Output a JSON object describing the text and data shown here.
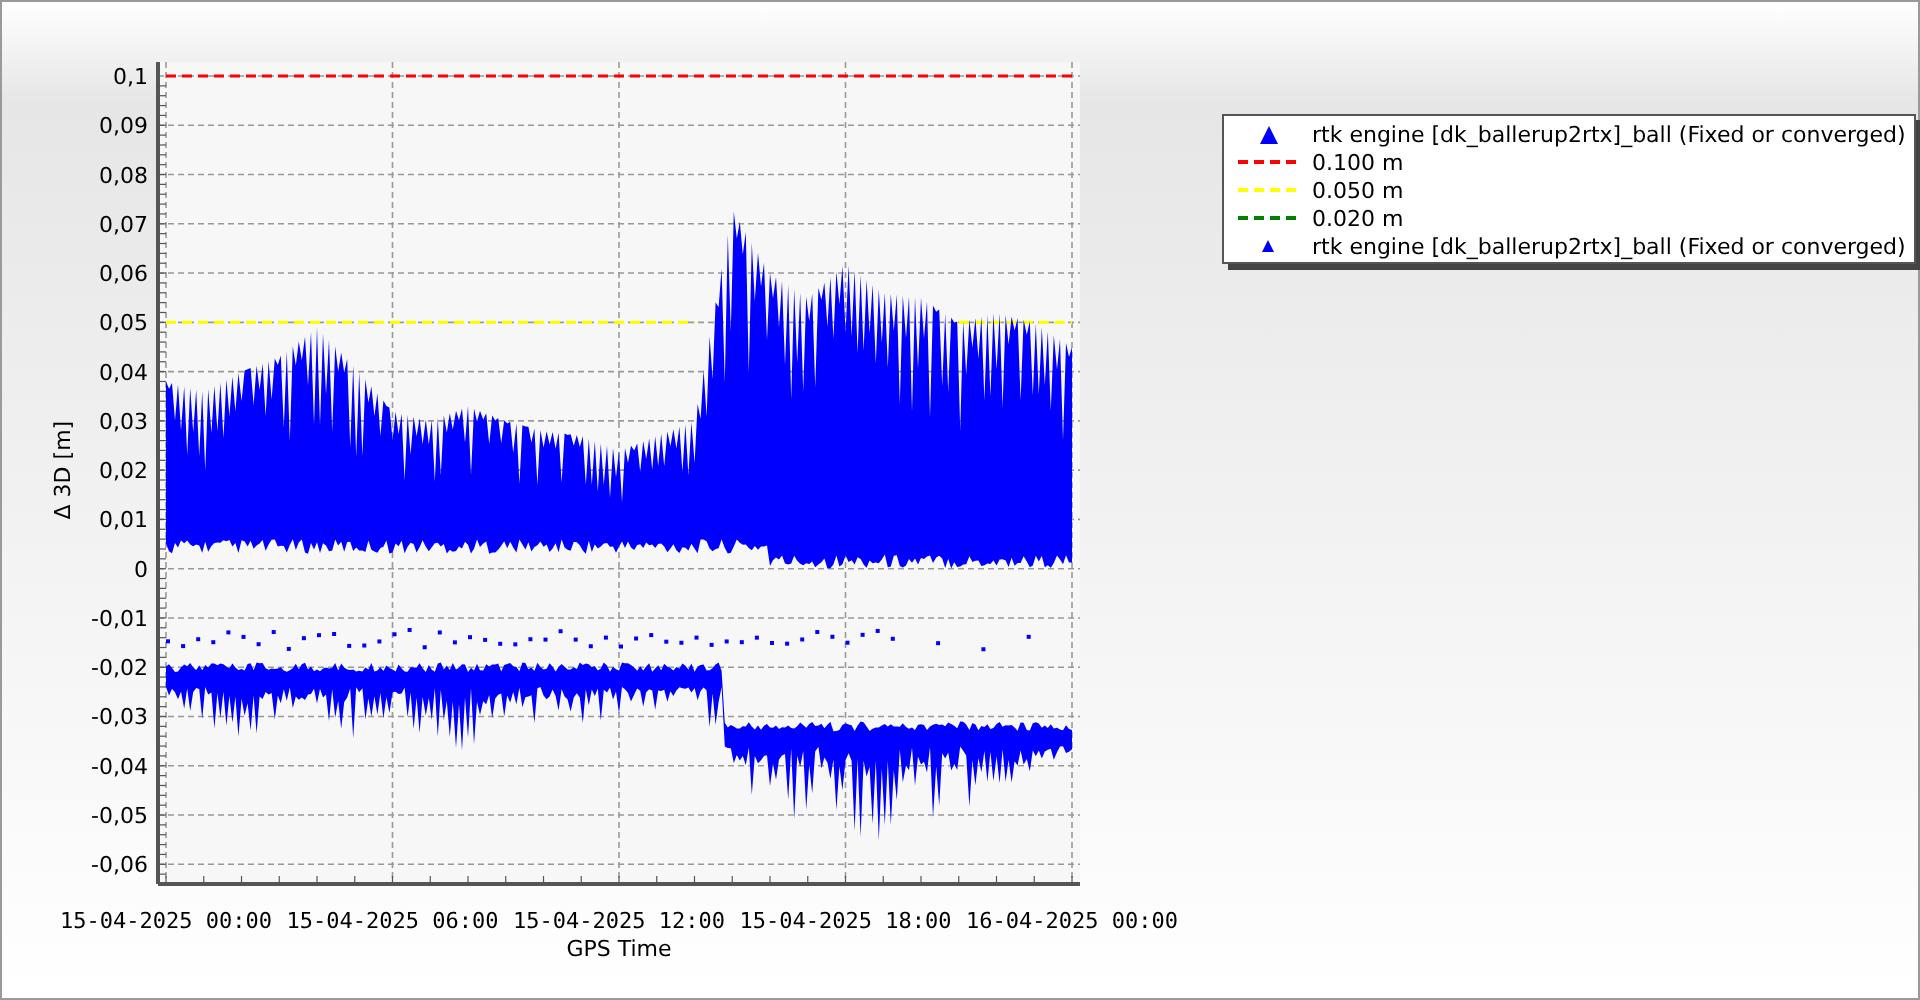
{
  "chart_data": {
    "type": "line",
    "xlabel": "GPS Time",
    "ylabel": "Δ 3D [m]",
    "grid": true,
    "categories": [
      "15-04-2025 00:00",
      null,
      null,
      null,
      null,
      null,
      "15-04-2025 06:00",
      null,
      null,
      null,
      null,
      null,
      "15-04-2025 12:00",
      null,
      null,
      null,
      null,
      null,
      "15-04-2025 18:00",
      null,
      null,
      null,
      null,
      null,
      "16-04-2025 00:00"
    ],
    "ylim": [
      -0.064,
      0.1
    ],
    "yticks": [
      {
        "value": 0.1,
        "label": "0,1"
      },
      {
        "value": 0.09,
        "label": "0,09"
      },
      {
        "value": 0.08,
        "label": "0,08"
      },
      {
        "value": 0.07,
        "label": "0,07"
      },
      {
        "value": 0.06,
        "label": "0,06"
      },
      {
        "value": 0.05,
        "label": "0,05"
      },
      {
        "value": 0.04,
        "label": "0,04"
      },
      {
        "value": 0.03,
        "label": "0,03"
      },
      {
        "value": 0.02,
        "label": "0,02"
      },
      {
        "value": 0.01,
        "label": "0,01"
      },
      {
        "value": 0,
        "label": "0"
      },
      {
        "value": -0.01,
        "label": "-0,01"
      },
      {
        "value": -0.02,
        "label": "-0,02"
      },
      {
        "value": -0.03,
        "label": "-0,03"
      },
      {
        "value": -0.04,
        "label": "-0,04"
      },
      {
        "value": -0.05,
        "label": "-0,05"
      },
      {
        "value": -0.06,
        "label": "-0,06"
      }
    ],
    "series": [
      {
        "name": "0.100 m",
        "color": "#ff0000",
        "line_style": "dashed",
        "values": [
          0.1,
          0.1,
          0.1,
          0.1,
          0.1,
          0.1,
          0.1,
          0.1,
          0.1,
          0.1,
          0.1,
          0.1,
          0.1,
          0.1,
          0.1,
          0.1,
          0.1,
          0.1,
          0.1,
          0.1,
          0.1,
          0.1,
          0.1,
          0.1,
          0.1
        ]
      },
      {
        "name": "0.050 m",
        "color": "#ffff00",
        "line_style": "dashed",
        "values": [
          0.05,
          0.05,
          0.05,
          0.05,
          0.05,
          0.05,
          0.05,
          0.05,
          0.05,
          0.05,
          0.05,
          0.05,
          0.05,
          0.05,
          0.05,
          null,
          null,
          null,
          null,
          null,
          null,
          0.05,
          0.05,
          0.05,
          0.05
        ]
      },
      {
        "name": "0.020 m",
        "color": "#008000",
        "line_style": "dashed",
        "values": [
          null,
          null,
          null,
          null,
          null,
          null,
          null,
          null,
          null,
          null,
          null,
          null,
          null,
          null,
          null,
          null,
          null,
          null,
          null,
          null,
          null,
          null,
          null,
          null,
          null
        ]
      }
    ]
  },
  "legend": {
    "items": [
      {
        "kind": "marker-large",
        "label": "rtk engine [dk_ballerup2rtx]_ball (Fixed or converged)",
        "color": "#0000ff"
      },
      {
        "kind": "marker-small",
        "label": "rtk engine [dk_ballerup2rtx]_ball (Fixed or converged)",
        "color": "#0000ff"
      }
    ]
  }
}
